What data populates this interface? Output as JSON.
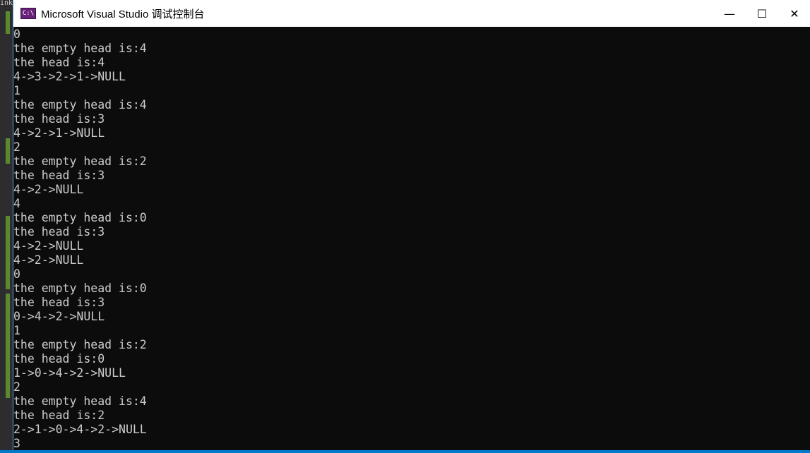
{
  "left_panel": {
    "tab_text": "ink"
  },
  "window": {
    "icon_text": "C:\\",
    "title": "Microsoft Visual Studio 调试控制台",
    "controls": {
      "minimize": "—",
      "maximize": "☐",
      "close": "✕"
    }
  },
  "console": {
    "lines": [
      "0",
      "the empty head is:4",
      "the head is:4",
      "4->3->2->1->NULL",
      "1",
      "the empty head is:4",
      "the head is:3",
      "4->2->1->NULL",
      "2",
      "the empty head is:2",
      "the head is:3",
      "4->2->NULL",
      "4",
      "the empty head is:0",
      "the head is:3",
      "4->2->NULL",
      "4->2->NULL",
      "0",
      "the empty head is:0",
      "the head is:3",
      "0->4->2->NULL",
      "1",
      "the empty head is:2",
      "the head is:0",
      "1->0->4->2->NULL",
      "2",
      "the empty head is:4",
      "the head is:2",
      "2->1->0->4->2->NULL",
      "3"
    ]
  }
}
